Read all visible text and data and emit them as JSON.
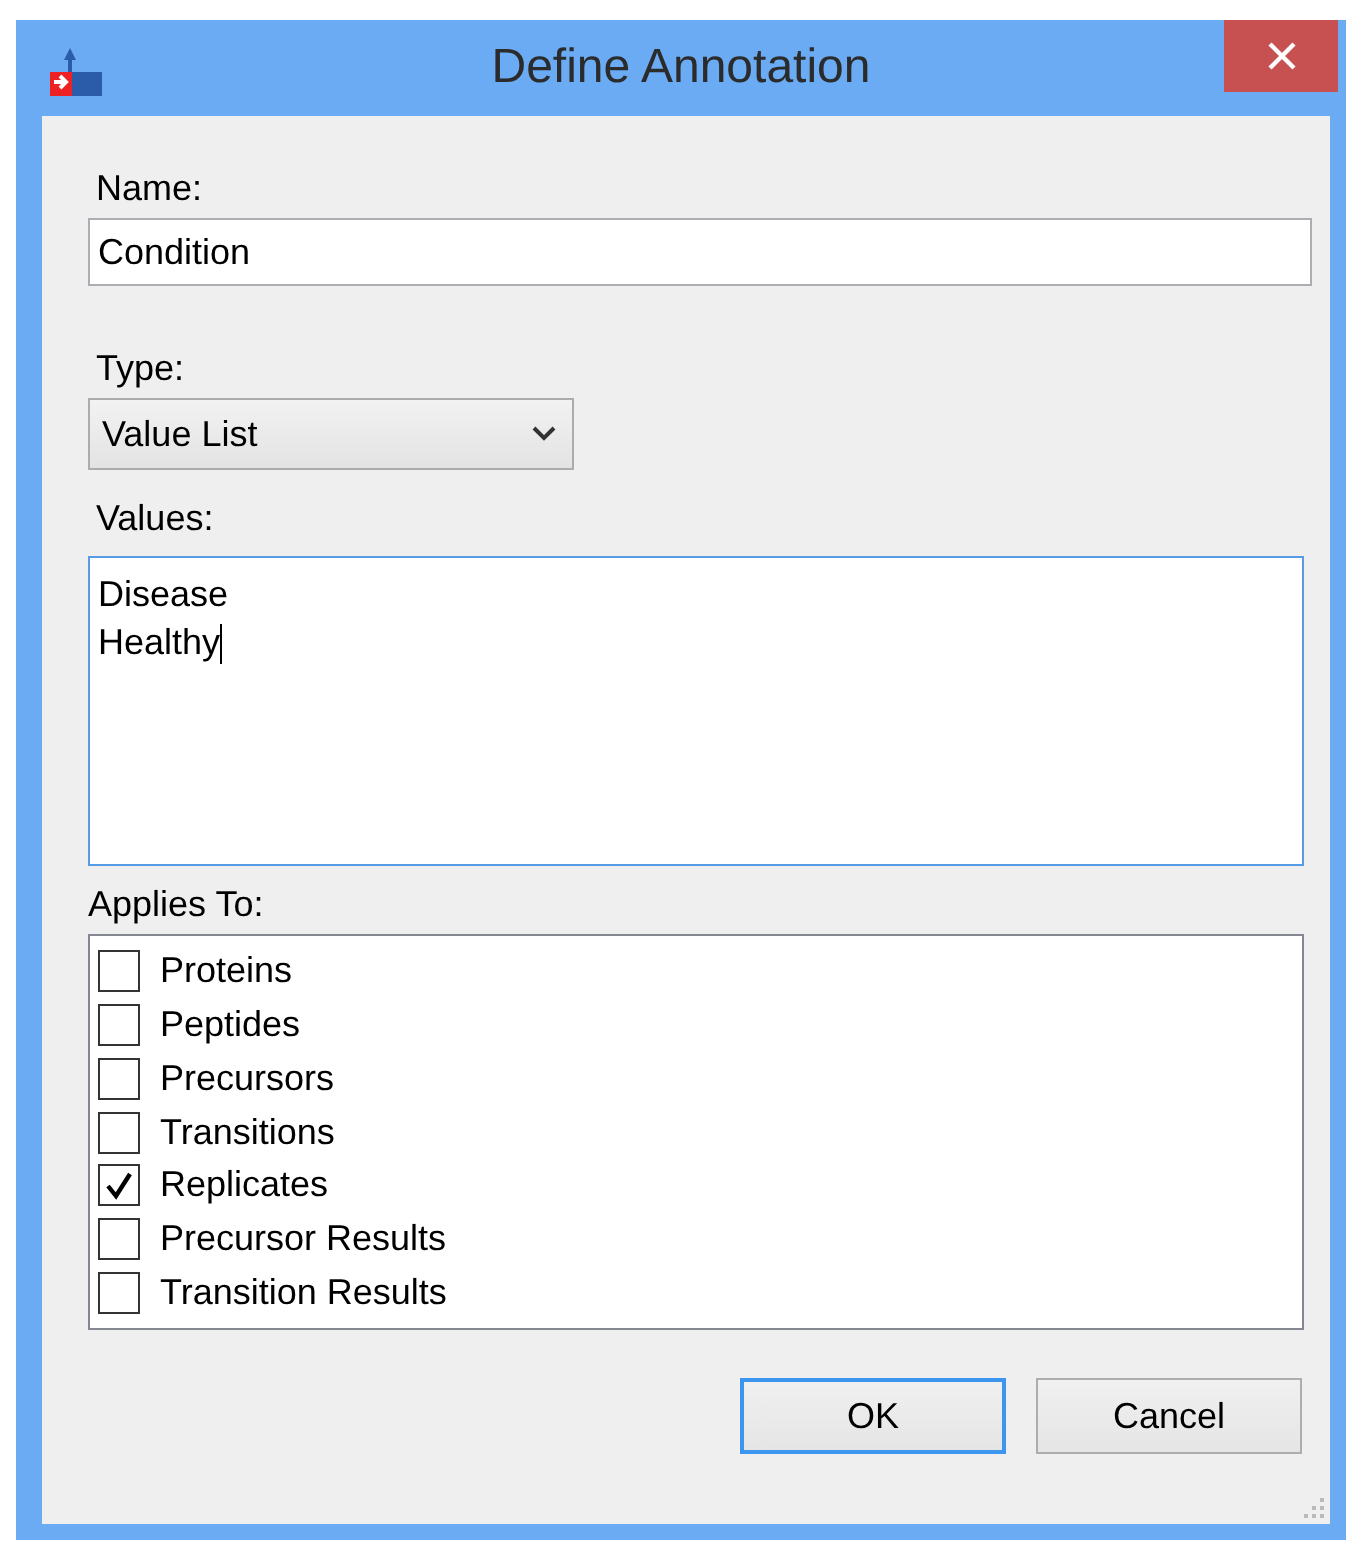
{
  "window": {
    "title": "Define Annotation"
  },
  "name": {
    "label": "Name:",
    "value": "Condition"
  },
  "type": {
    "label": "Type:",
    "value": "Value List"
  },
  "values": {
    "label": "Values:",
    "lines": [
      "Disease",
      "Healthy"
    ],
    "focused": true
  },
  "applies_to": {
    "label": "Applies To:",
    "items": [
      {
        "label": "Proteins",
        "checked": false
      },
      {
        "label": "Peptides",
        "checked": false
      },
      {
        "label": "Precursors",
        "checked": false
      },
      {
        "label": "Transitions",
        "checked": false
      },
      {
        "label": "Replicates",
        "checked": true
      },
      {
        "label": "Precursor Results",
        "checked": false
      },
      {
        "label": "Transition Results",
        "checked": false
      }
    ]
  },
  "buttons": [
    {
      "label": "OK",
      "default": true
    },
    {
      "label": "Cancel",
      "default": false
    }
  ]
}
